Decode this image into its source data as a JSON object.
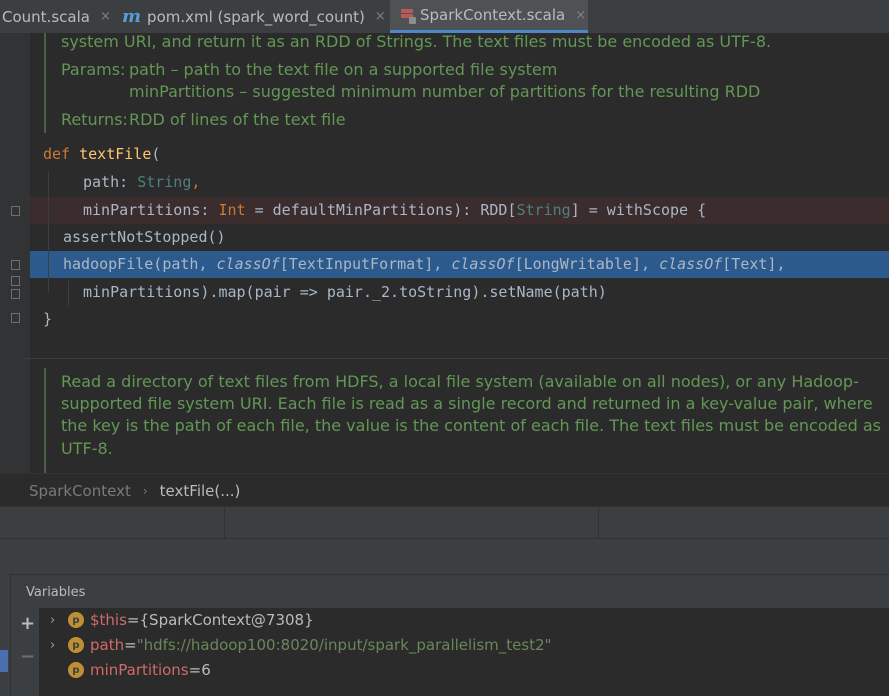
{
  "tabs": [
    {
      "label": "Count.scala",
      "icon": "none",
      "close": "×"
    },
    {
      "label": "pom.xml (spark_word_count)",
      "icon": "maven-m-icon",
      "close": "×"
    },
    {
      "label": "SparkContext.scala",
      "icon": "scala-file-icon",
      "close": "×",
      "active": true
    }
  ],
  "doc_top": {
    "line1": "system URI, and return it as an RDD of Strings. The text files must be encoded as UTF-8.",
    "params_label": "Params:",
    "param1": "path – path to the text file on a supported file system",
    "param2": "minPartitions – suggested minimum number of partitions for the resulting RDD",
    "returns_label": "Returns:",
    "returns": "RDD of lines of the text file"
  },
  "code": {
    "l1_kw": "def",
    "l1_fn": "textFile",
    "l1_rest": "(",
    "l2_a": "path: ",
    "l2_t": "String",
    "l2_b": ",",
    "l3_a": "minPartitions: ",
    "l3_t": "Int",
    "l3_b": " = defaultMinPartitions): RDD[",
    "l3_t2": "String",
    "l3_c": "] = withScope {",
    "l4": "assertNotStopped()",
    "l5_a": "hadoopFile(path, ",
    "l5_i1": "classOf",
    "l5_b": "[TextInputFormat], ",
    "l5_i2": "classOf",
    "l5_c": "[LongWritable], ",
    "l5_i3": "classOf",
    "l5_d": "[Text],",
    "l6": "minPartitions).map(pair => pair._2.toString).setName(path)",
    "l7": "}"
  },
  "doc_bottom": {
    "line1": "Read a directory of text files from HDFS, a local file system (available on all nodes), or any Hadoop-",
    "line2": "supported file system URI. Each file is read as a single record and returned in a key-value pair, where",
    "line3": "the key is the path of each file, the value is the content of each file. The text files must be encoded as",
    "line4": "UTF-8."
  },
  "breadcrumb": {
    "class": "SparkContext",
    "separator": "›",
    "method": "textFile(...)"
  },
  "variables": {
    "title": "Variables",
    "add_icon": "+",
    "remove_icon": "−",
    "rows": [
      {
        "expand": "›",
        "badge": "p",
        "name": "$this",
        "eq": " = ",
        "value": "{SparkContext@7308}",
        "type": "object"
      },
      {
        "expand": "›",
        "badge": "p",
        "name": "path",
        "eq": " = ",
        "value": "\"hdfs://hadoop100:8020/input/spark_parallelism_test2\"",
        "type": "string"
      },
      {
        "expand": "",
        "badge": "p",
        "name": "minPartitions",
        "eq": " = ",
        "value": "6",
        "type": "number"
      }
    ]
  },
  "colors": {
    "editor_bg": "#2b2b2b",
    "selection": "#2d5a8c",
    "doc_comment": "#629755",
    "keyword": "#cc7832",
    "function": "#ffc66d"
  }
}
